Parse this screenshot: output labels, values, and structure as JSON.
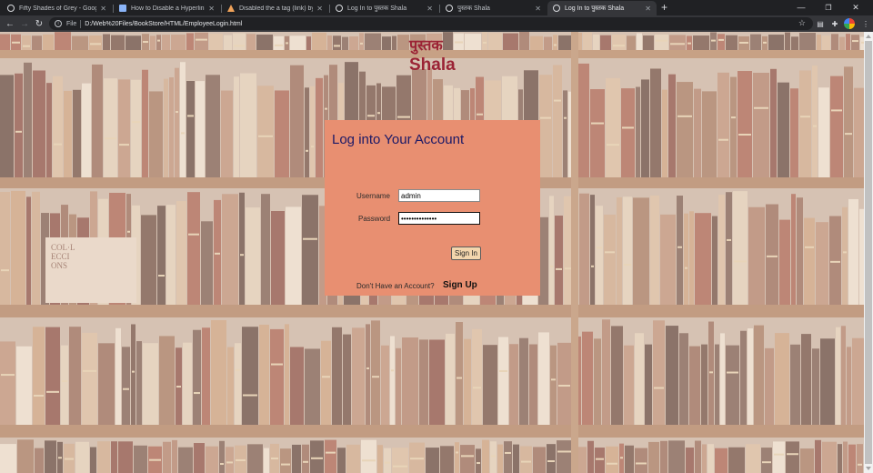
{
  "browser": {
    "tabs": [
      {
        "title": "Fifty Shades of Grey - Google Se",
        "icon": "google-g-icon"
      },
      {
        "title": "How to Disable a Hyperlink usin",
        "icon": "document-icon"
      },
      {
        "title": "Disabled the a tag (link) by using",
        "icon": "warning-icon"
      },
      {
        "title": "Log In to पुस्तक Shala",
        "icon": "globe-icon"
      },
      {
        "title": "पुस्तक Shala",
        "icon": "globe-icon"
      },
      {
        "title": "Log In to पुस्तक Shala",
        "icon": "globe-icon",
        "active": true
      }
    ],
    "address": {
      "scheme": "File",
      "url": "D:/Web%20Files/BookStore/HTML/EmployeeLogin.html"
    }
  },
  "page": {
    "logo_line1": "पुस्तक",
    "logo_line2": "Shala",
    "heading": "Log into Your Account",
    "username_label": "Username",
    "username_value": "admin",
    "password_label": "Password",
    "password_value": "••••••••••••••",
    "signin_label": "Sign In",
    "no_account_text": "Don't Have an Account?",
    "signup_label": "Sign Up"
  },
  "colors": {
    "card": "#e88f71",
    "heading": "#1b1967",
    "logo": "#9b2335",
    "button": "#f3d6ad"
  }
}
